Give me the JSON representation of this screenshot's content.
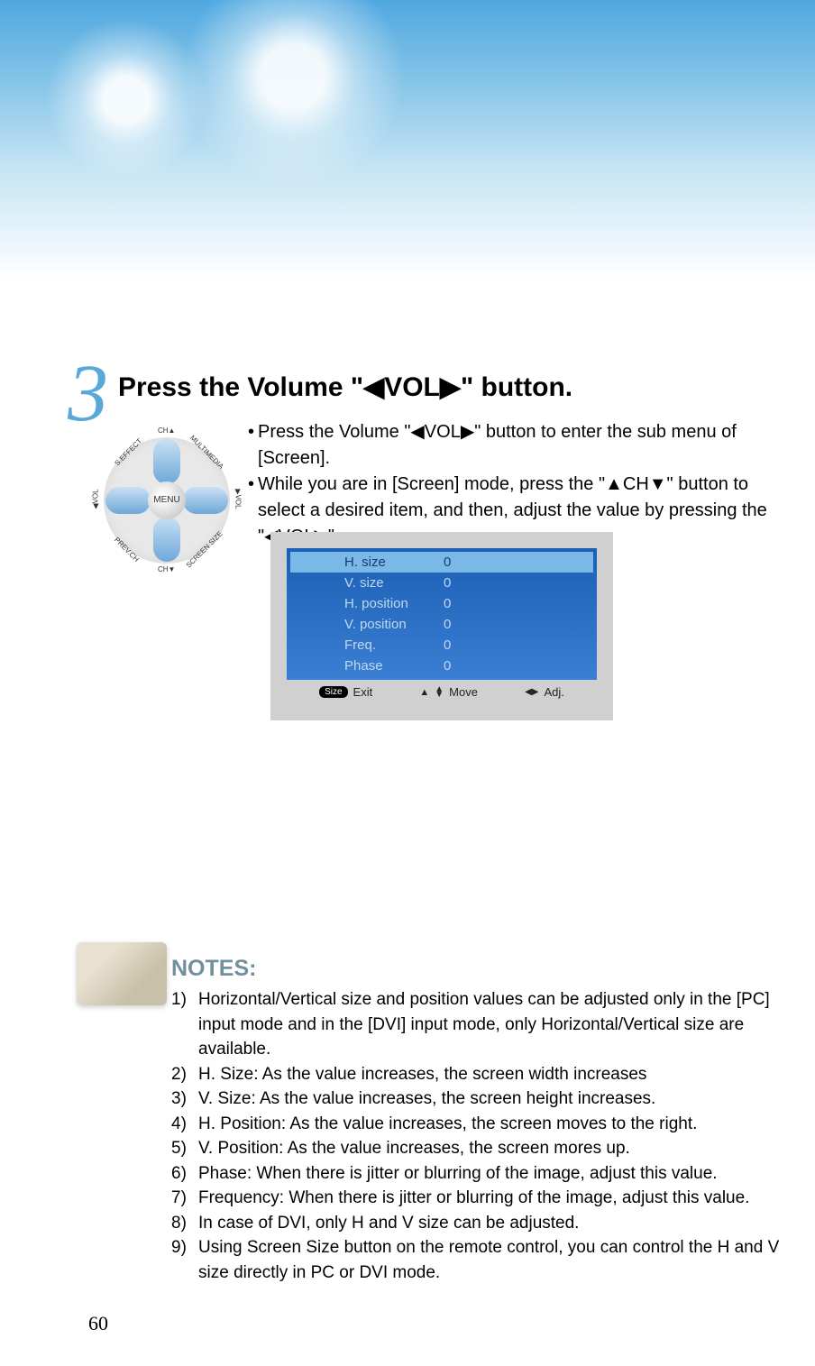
{
  "banner": {},
  "step": {
    "number": "3",
    "title_before": "Press the Volume \"",
    "title_vol": "VOL",
    "title_after": "\" button.",
    "bullets": [
      "Press the Volume \"◀VOL▶\" button to enter the sub menu of [Screen].",
      "While you are in [Screen] mode, press the \"▲CH▼\" button to select a desired item, and then, adjust the value by pressing the \"◀VOL▶\"."
    ]
  },
  "remote": {
    "center": "MENU",
    "top": "CH▲",
    "bottom": "CH▼",
    "left": "◀VOL",
    "right": "▶VOL",
    "tl": "S.EFFECT",
    "tr": "MULTIMEDIA",
    "bl": "PREV.CH",
    "br": "SCREEN SIZE"
  },
  "osd": {
    "rows": [
      {
        "label": "H. size",
        "value": "0",
        "selected": true
      },
      {
        "label": "V. size",
        "value": "0",
        "selected": false
      },
      {
        "label": "H. position",
        "value": "0",
        "selected": false
      },
      {
        "label": "V. position",
        "value": "0",
        "selected": false
      },
      {
        "label": "Freq.",
        "value": "0",
        "selected": false
      },
      {
        "label": "Phase",
        "value": "0",
        "selected": false
      }
    ],
    "footer": {
      "size_badge": "Size",
      "exit": "Exit",
      "move_icon": "▲▼",
      "move": "Move",
      "adj_icon": "◀▶",
      "adj": "Adj."
    }
  },
  "notes": {
    "title": "NOTES:",
    "items": [
      "Horizontal/Vertical size and position values can be adjusted only in the [PC] input mode and in the [DVI] input mode, only Horizontal/Vertical size are available.",
      "H. Size: As the value increases, the screen width increases",
      "V. Size: As the value increases, the screen height increases.",
      "H. Position: As the value increases, the screen moves to the right.",
      "V. Position: As the value increases, the screen mores up.",
      "Phase: When there is jitter or blurring of the image, adjust this value.",
      "Frequency: When there is jitter or blurring of the image, adjust this value.",
      "In case of DVI, only H and V size can be adjusted.",
      "Using Screen Size button on the remote control, you can control the H and V size directly in PC or DVI mode."
    ]
  },
  "page_number": "60"
}
